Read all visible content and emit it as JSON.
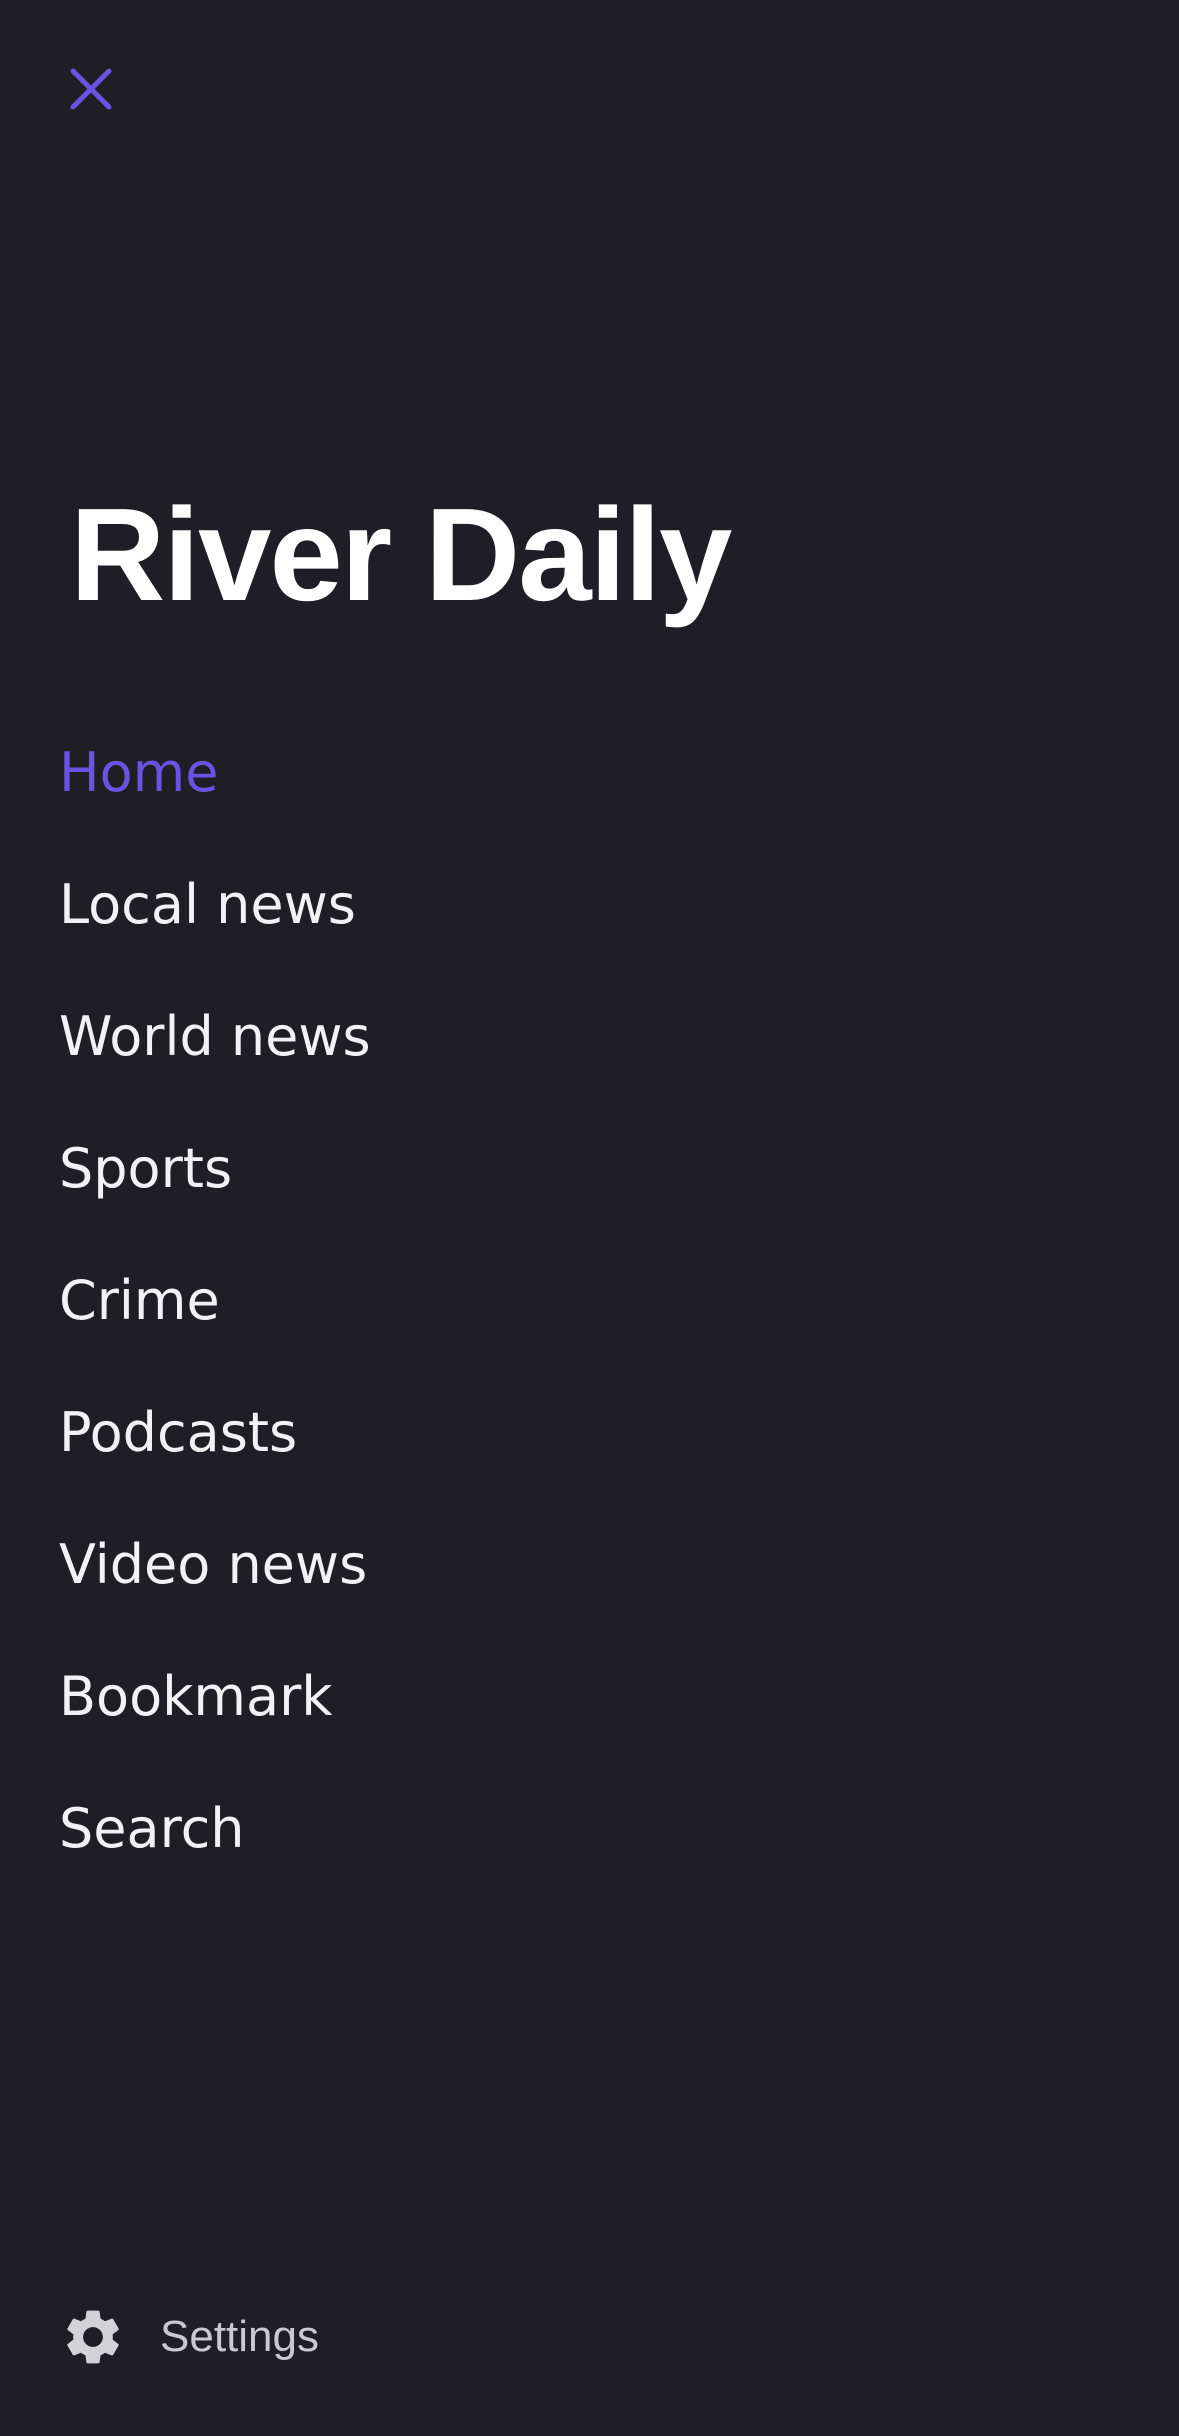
{
  "menu": {
    "title": "River Daily",
    "items": [
      {
        "label": "Home",
        "active": true
      },
      {
        "label": "Local news",
        "active": false
      },
      {
        "label": "World news",
        "active": false
      },
      {
        "label": "Sports",
        "active": false
      },
      {
        "label": "Crime",
        "active": false
      },
      {
        "label": "Podcasts",
        "active": false
      },
      {
        "label": "Video news",
        "active": false
      },
      {
        "label": "Bookmark",
        "active": false
      },
      {
        "label": "Search",
        "active": false
      }
    ],
    "settings_label": "Settings"
  },
  "icons": {
    "close": "close-icon",
    "settings": "gear-icon"
  },
  "colors": {
    "background": "#1f1e25",
    "accent": "#6a53e3",
    "text": "#f2f2f5",
    "muted": "#c9c9cf"
  }
}
